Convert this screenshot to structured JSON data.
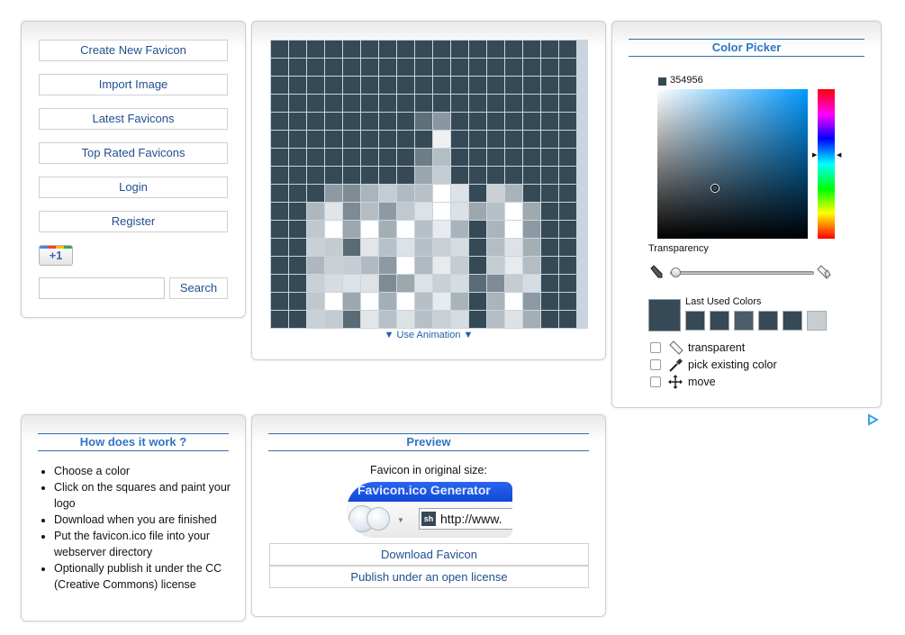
{
  "nav": {
    "create": "Create New Favicon",
    "import": "Import Image",
    "latest": "Latest Favicons",
    "top": "Top Rated Favicons",
    "login": "Login",
    "register": "Register",
    "plus_one": "+1",
    "search_placeholder": "",
    "search_button": "Search"
  },
  "editor": {
    "use_animation": "Use Animation",
    "grid_cols": 17,
    "grid_rows": 16,
    "base_color": "#354956",
    "pixels": [
      [
        8,
        8,
        "#5f6f7a"
      ],
      [
        9,
        8,
        "#8a97a0"
      ],
      [
        9,
        9,
        "#eef0f2"
      ],
      [
        9,
        10,
        "#b3bdc4"
      ],
      [
        8,
        10,
        "#6f7d86"
      ],
      [
        8,
        11,
        "#9aa6ae"
      ],
      [
        9,
        11,
        "#c5ccd2"
      ],
      [
        8,
        12,
        "#b8c1c8"
      ],
      [
        9,
        12,
        "#ffffff"
      ],
      [
        10,
        12,
        "#dde2e6"
      ],
      [
        12,
        12,
        "#c9d0d6"
      ],
      [
        13,
        12,
        "#a9b3ba"
      ],
      [
        3,
        12,
        "#8e9aa3"
      ],
      [
        4,
        12,
        "#7f8c95"
      ],
      [
        5,
        12,
        "#aab4bb"
      ],
      [
        6,
        12,
        "#c5ccd2"
      ],
      [
        7,
        12,
        "#b1bac1"
      ],
      [
        2,
        13,
        "#aeb7be"
      ],
      [
        3,
        13,
        "#e1e5e8"
      ],
      [
        4,
        13,
        "#7e8b94"
      ],
      [
        5,
        13,
        "#b4bdc4"
      ],
      [
        6,
        13,
        "#8e9aa3"
      ],
      [
        7,
        13,
        "#c1c9cf"
      ],
      [
        8,
        13,
        "#dde2e6"
      ],
      [
        9,
        13,
        "#ffffff"
      ],
      [
        10,
        13,
        "#dce1e5"
      ],
      [
        11,
        13,
        "#9ca7ae"
      ],
      [
        12,
        13,
        "#b6bfc6"
      ],
      [
        13,
        13,
        "#ffffff"
      ],
      [
        14,
        13,
        "#9ea9b0"
      ],
      [
        2,
        14,
        "#c0c8ce"
      ],
      [
        3,
        14,
        "#ffffff"
      ],
      [
        4,
        14,
        "#9ca7ae"
      ],
      [
        5,
        14,
        "#ffffff"
      ],
      [
        6,
        14,
        "#a4aeb5"
      ],
      [
        7,
        14,
        "#ffffff"
      ],
      [
        8,
        14,
        "#b7c0c7"
      ],
      [
        9,
        14,
        "#e7ebee"
      ],
      [
        10,
        14,
        "#a9b3ba"
      ],
      [
        12,
        14,
        "#aab4bb"
      ],
      [
        13,
        14,
        "#ffffff"
      ],
      [
        14,
        14,
        "#8e9aa3"
      ],
      [
        2,
        15,
        "#c9d0d6"
      ],
      [
        3,
        15,
        "#c4cbd1"
      ],
      [
        4,
        15,
        "#5b6b76"
      ],
      [
        5,
        15,
        "#e2e6e9"
      ],
      [
        6,
        15,
        "#b8c1c8"
      ],
      [
        7,
        15,
        "#dde2e6"
      ],
      [
        8,
        15,
        "#b7c0c7"
      ],
      [
        9,
        15,
        "#c8cfd5"
      ],
      [
        10,
        15,
        "#d7dce0"
      ],
      [
        12,
        15,
        "#b4bdc4"
      ],
      [
        13,
        15,
        "#dde2e6"
      ],
      [
        14,
        15,
        "#a4aeb5"
      ],
      [
        2,
        16,
        "#aeb7be"
      ],
      [
        3,
        16,
        "#c9d0d6"
      ],
      [
        4,
        16,
        "#c5ccd2"
      ],
      [
        5,
        16,
        "#b1bac1"
      ],
      [
        6,
        16,
        "#8e9aa3"
      ],
      [
        7,
        16,
        "#ffffff"
      ],
      [
        8,
        16,
        "#b1bac1"
      ],
      [
        9,
        16,
        "#e7ebee"
      ],
      [
        10,
        16,
        "#c5ccd2"
      ],
      [
        12,
        16,
        "#c5ccd2"
      ],
      [
        13,
        16,
        "#e7ebee"
      ],
      [
        14,
        16,
        "#b4bdc4"
      ],
      [
        2,
        17,
        "#c9d0d6"
      ],
      [
        3,
        17,
        "#d7dce0"
      ],
      [
        4,
        17,
        "#dde2e6"
      ],
      [
        5,
        17,
        "#dde2e6"
      ],
      [
        6,
        17,
        "#7e8b94"
      ],
      [
        7,
        17,
        "#9ca7ae"
      ],
      [
        8,
        17,
        "#dde2e6"
      ],
      [
        9,
        17,
        "#c9d0d6"
      ],
      [
        10,
        17,
        "#d7dce0"
      ],
      [
        11,
        17,
        "#5b6b76"
      ],
      [
        12,
        17,
        "#7f8c95"
      ],
      [
        13,
        17,
        "#c5ccd2"
      ],
      [
        14,
        17,
        "#d7dce0"
      ]
    ]
  },
  "color_picker": {
    "title": "Color Picker",
    "hex": "354956",
    "current_color": "#354956",
    "transparency_label": "Transparency",
    "transparency_value": 0,
    "last_used_label": "Last Used Colors",
    "last_used": [
      "#354956",
      "#354956",
      "#4b5d69",
      "#354956",
      "#354956",
      "#c8cdd1"
    ],
    "opt_transparent": "transparent",
    "opt_pick": "pick existing color",
    "opt_move": "move"
  },
  "how": {
    "title": "How does it work ?",
    "steps": [
      "Choose a color",
      "Click on the squares and paint your logo",
      "Download when you are finished",
      "Put the favicon.ico file into your webserver directory",
      "Optionally publish it under the CC (Creative Commons) license"
    ]
  },
  "preview": {
    "title": "Preview",
    "caption": "Favicon in original size:",
    "browser_title": "Favicon.ico Generator",
    "favicon_text": "sh",
    "url_text": "http://www.",
    "download": "Download Favicon",
    "publish": "Publish under an open license"
  }
}
